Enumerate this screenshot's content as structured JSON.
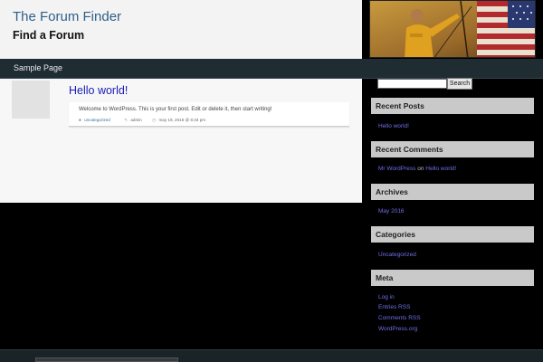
{
  "site": {
    "title": "The Forum Finder",
    "description": "Find a Forum"
  },
  "nav": {
    "items": [
      "Sample Page"
    ]
  },
  "post": {
    "title": "Hello world!",
    "excerpt": "Welcome to WordPress. This is your first post. Edit or delete it, then start writing!",
    "category": "uncategorized",
    "author": "admin",
    "date": "may 19, 2016 @ 6:34 pm"
  },
  "search": {
    "button_label": "Search",
    "value": ""
  },
  "widgets": {
    "recent_posts": {
      "title": "Recent Posts",
      "items": [
        "Hello world!"
      ]
    },
    "recent_comments": {
      "title": "Recent Comments",
      "author": "Mr WordPress",
      "joiner": "on",
      "post": "Hello world!"
    },
    "archives": {
      "title": "Archives",
      "items": [
        "May 2016"
      ]
    },
    "categories": {
      "title": "Categories",
      "items": [
        "Uncategorized"
      ]
    },
    "meta": {
      "title": "Meta",
      "items": [
        "Log in",
        "Entries RSS",
        "Comments RSS",
        "WordPress.org"
      ]
    }
  },
  "icons": {
    "category": "folder-icon",
    "author": "pencil-icon",
    "date": "clock-icon"
  },
  "colors": {
    "link": "#6f6fe8",
    "post_title": "#1a1ab8",
    "site_title": "#2f5f8a",
    "nav_bg": "#1f2d33",
    "widget_head_bg": "#c9c9c9"
  }
}
